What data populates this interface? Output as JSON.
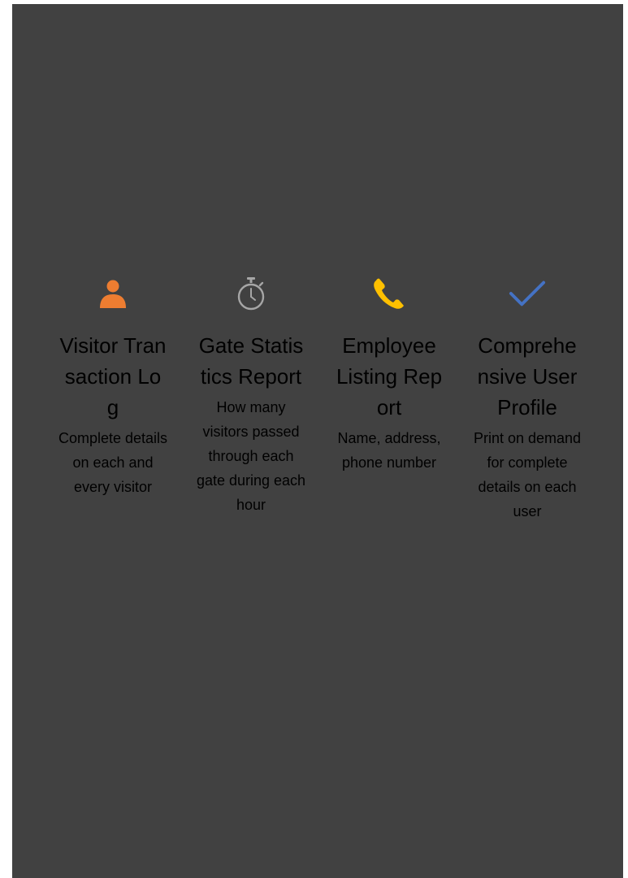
{
  "colors": {
    "background": "#414141",
    "person_icon": "#ED7D31",
    "stopwatch_icon": "#A6A6A6",
    "phone_icon": "#FFC000",
    "check_icon": "#4472C4",
    "text": "#000000"
  },
  "features": [
    {
      "icon": "person-icon",
      "title": "Visitor Transaction Log",
      "description": "Complete details on each and every visitor"
    },
    {
      "icon": "stopwatch-icon",
      "title": "Gate Statistics Report",
      "description": "How many visitors passed through each gate during each hour"
    },
    {
      "icon": "phone-icon",
      "title": "Employee Listing Report",
      "description": "Name, address, phone number"
    },
    {
      "icon": "checkmark-icon",
      "title": "Comprehensive User Profile",
      "description": "Print on demand for complete details on each user"
    }
  ]
}
